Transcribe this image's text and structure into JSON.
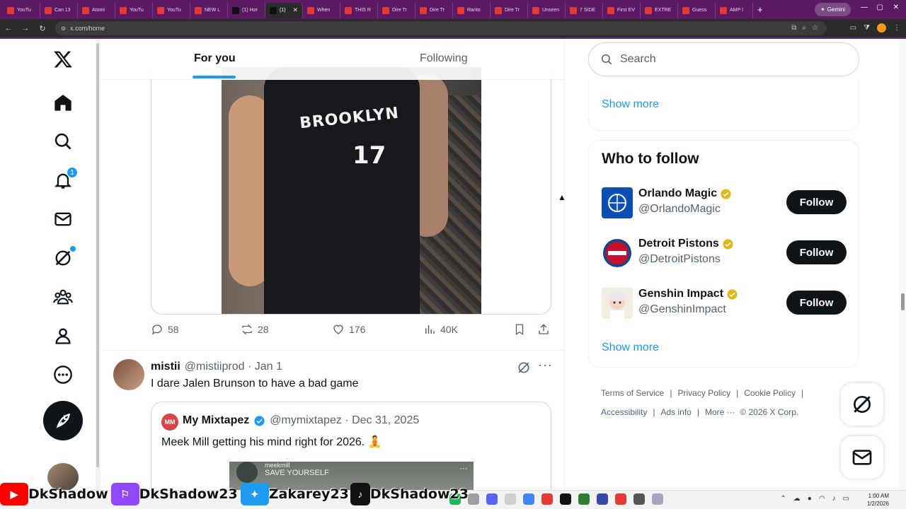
{
  "browser": {
    "tabs": [
      {
        "label": "YouTu",
        "fav": "red"
      },
      {
        "label": "Can 13",
        "fav": "red"
      },
      {
        "label": "Atomi",
        "fav": "red"
      },
      {
        "label": "YouTu",
        "fav": "red"
      },
      {
        "label": "YouTu",
        "fav": "red"
      },
      {
        "label": "NEW L",
        "fav": "red"
      },
      {
        "label": "(1) Hor",
        "fav": "x"
      },
      {
        "label": "(1)",
        "fav": "x",
        "active": true
      },
      {
        "label": "When",
        "fav": "red"
      },
      {
        "label": "THIS R",
        "fav": "red"
      },
      {
        "label": "Dire Tr",
        "fav": "red"
      },
      {
        "label": "Dire Tr",
        "fav": "red"
      },
      {
        "label": "Ranto",
        "fav": "red"
      },
      {
        "label": "Dire Tr",
        "fav": "red"
      },
      {
        "label": "Unseen",
        "fav": "red"
      },
      {
        "label": "7 SIDE",
        "fav": "red"
      },
      {
        "label": "First EV",
        "fav": "red"
      },
      {
        "label": "EXTRE",
        "fav": "red"
      },
      {
        "label": "Guess",
        "fav": "red"
      },
      {
        "label": "AMP I",
        "fav": "red"
      }
    ],
    "gemini_label": "Gemini",
    "url": "x.com/home"
  },
  "feed": {
    "tabs": {
      "for_you": "For you",
      "following": "Following"
    },
    "post1": {
      "jersey_text": "BROOKLYN",
      "jersey_number": "17",
      "replies": "58",
      "reposts": "28",
      "likes": "176",
      "views": "40K"
    },
    "post2": {
      "name": "mistii",
      "handle": "@mistiiprod · Jan 1",
      "text": "I dare Jalen Brunson to have a bad game",
      "quote": {
        "avatar_text": "MM",
        "name": "My Mixtapez",
        "handle": "@mymixtapez · Dec 31, 2025",
        "text": "Meek Mill getting his mind right for 2026. 🧘",
        "media_user": "meekmill",
        "media_caption": "SAVE YOURSELF"
      }
    }
  },
  "nav": {
    "notification_count": "1"
  },
  "sidebar": {
    "search_placeholder": "Search",
    "show_more_1": "Show more",
    "who_to_follow_title": "Who to follow",
    "suggestions": [
      {
        "name": "Orlando Magic",
        "handle": "@OrlandoMagic",
        "button": "Follow"
      },
      {
        "name": "Detroit Pistons",
        "handle": "@DetroitPistons",
        "button": "Follow"
      },
      {
        "name": "Genshin Impact",
        "handle": "@GenshinImpact",
        "button": "Follow"
      }
    ],
    "show_more_2": "Show more",
    "footer": {
      "terms": "Terms of Service",
      "privacy": "Privacy Policy",
      "cookie": "Cookie Policy",
      "accessibility": "Accessibility",
      "ads": "Ads info",
      "more": "More ···",
      "copyright": "© 2026 X Corp."
    }
  },
  "taskbar": {
    "overlay": [
      "DkShadow",
      "DkShadow23",
      "Zakarey23",
      "DkShadow23"
    ],
    "time": "1:00 AM",
    "date": "1/2/2026"
  },
  "colors": {
    "accent": "#1d9bf0",
    "text": "#0f1419",
    "muted": "#536471",
    "brand_bar": "#5b1a63"
  }
}
